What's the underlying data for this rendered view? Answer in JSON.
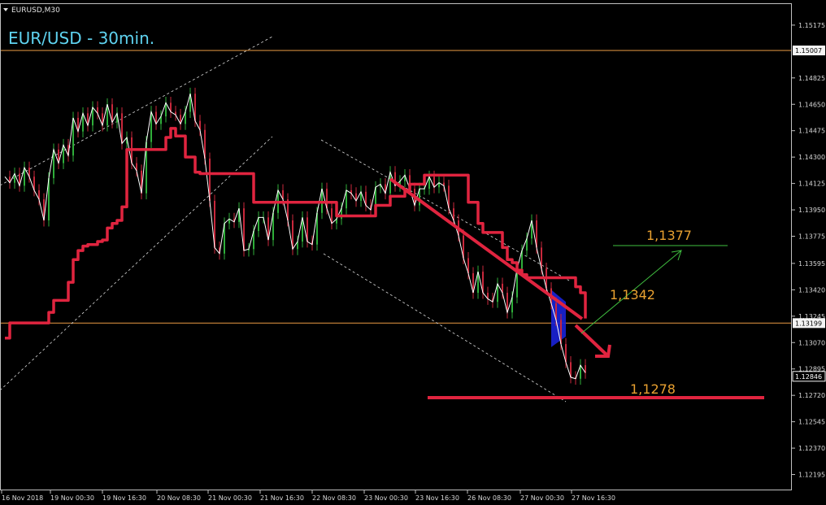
{
  "window": {
    "symbol_label": "EURUSD,M30",
    "menu_icon": "triangle-down-icon"
  },
  "colors": {
    "background": "#000000",
    "frame": "#c0c0c0",
    "grid_text": "#d6d6d6",
    "hline": "#d08a3c",
    "kijun": "#e0243f",
    "close_line": "#ffffff",
    "candles": "#2fae3a",
    "candles_down": "#c8283c",
    "channel": "#dcdcdc",
    "target": "#e8a030",
    "bull_arrow": "#40c040",
    "cloud": "#1a22d8",
    "title": "#5fd3f0"
  },
  "chart_data": {
    "type": "line",
    "title": "EUR/USD - 30min.",
    "xlabel": "",
    "ylabel": "",
    "ylim": [
      1.1209,
      1.1532
    ],
    "y_ticks": [
      "1.15175",
      "1.15007",
      "1.14825",
      "1.14650",
      "1.14475",
      "1.14300",
      "1.14125",
      "1.13950",
      "1.13775",
      "1.13595",
      "1.13420",
      "1.13245",
      "1.13199",
      "1.13070",
      "1.12895",
      "1.12846",
      "1.12720",
      "1.12545",
      "1.12370",
      "1.12195"
    ],
    "x_ticks": [
      "16 Nov 2018",
      "19 Nov 00:30",
      "19 Nov 16:30",
      "20 Nov 08:30",
      "21 Nov 00:30",
      "21 Nov 16:30",
      "22 Nov 08:30",
      "23 Nov 00:30",
      "23 Nov 16:30",
      "26 Nov 08:30",
      "27 Nov 00:30",
      "27 Nov 16:30"
    ],
    "horizontal_lines": [
      {
        "value": 1.15007,
        "label": "1.15007"
      },
      {
        "value": 1.13199,
        "label": "1.13199"
      }
    ],
    "current_price": {
      "value": 1.12846,
      "label": "1.12846"
    },
    "annotations": [
      {
        "text": "1,1377",
        "kind": "bullish-target"
      },
      {
        "text": "1,1342",
        "kind": "resistance"
      },
      {
        "text": "1,1278",
        "kind": "support"
      }
    ],
    "series": [
      {
        "kind": "close",
        "values": [
          1.1417,
          1.1413,
          1.1419,
          1.1411,
          1.1423,
          1.1417,
          1.1408,
          1.1402,
          1.1388,
          1.1416,
          1.1435,
          1.1426,
          1.1438,
          1.1431,
          1.1456,
          1.1447,
          1.1459,
          1.1451,
          1.1463,
          1.1459,
          1.1451,
          1.1465,
          1.1453,
          1.1459,
          1.1439,
          1.1443,
          1.1426,
          1.1421,
          1.1406,
          1.144,
          1.146,
          1.1452,
          1.1457,
          1.1466,
          1.146,
          1.1458,
          1.1452,
          1.146,
          1.1472,
          1.1454,
          1.1448,
          1.1429,
          1.1401,
          1.137,
          1.1366,
          1.1386,
          1.1389,
          1.1387,
          1.1396,
          1.1368,
          1.1369,
          1.1381,
          1.139,
          1.139,
          1.1375,
          1.1393,
          1.1408,
          1.1402,
          1.1388,
          1.1369,
          1.1374,
          1.139,
          1.1374,
          1.1372,
          1.1393,
          1.1409,
          1.1396,
          1.1386,
          1.1389,
          1.1396,
          1.1408,
          1.1406,
          1.1401,
          1.1407,
          1.1398,
          1.1395,
          1.141,
          1.1412,
          1.1406,
          1.142,
          1.1411,
          1.1414,
          1.1418,
          1.1409,
          1.1398,
          1.1409,
          1.1409,
          1.1417,
          1.141,
          1.1413,
          1.1411,
          1.1396,
          1.1388,
          1.1378,
          1.1363,
          1.1353,
          1.134,
          1.1354,
          1.134,
          1.1336,
          1.1334,
          1.1346,
          1.134,
          1.1327,
          1.1337,
          1.1356,
          1.1368,
          1.1376,
          1.1388,
          1.137,
          1.1356,
          1.1343,
          1.1333,
          1.1322,
          1.1306,
          1.1294,
          1.1284,
          1.1283,
          1.1292,
          1.1287
        ]
      },
      {
        "kind": "kijun",
        "values": [
          1.131,
          1.132,
          1.132,
          1.132,
          1.132,
          1.132,
          1.132,
          1.132,
          1.132,
          1.1327,
          1.1335,
          1.1335,
          1.1335,
          1.1347,
          1.1362,
          1.1368,
          1.1371,
          1.1372,
          1.1372,
          1.1374,
          1.1375,
          1.1383,
          1.1386,
          1.1388,
          1.1397,
          1.1435,
          1.1435,
          1.1435,
          1.1435,
          1.1435,
          1.1435,
          1.1435,
          1.1435,
          1.1443,
          1.1449,
          1.1444,
          1.1444,
          1.143,
          1.143,
          1.142,
          1.1419,
          1.1419,
          1.1419,
          1.1419,
          1.1419,
          1.1419,
          1.1419,
          1.1419,
          1.1419,
          1.1419,
          1.1419,
          1.14,
          1.14,
          1.14,
          1.14,
          1.14,
          1.14,
          1.14,
          1.14,
          1.14,
          1.14,
          1.14,
          1.14,
          1.14,
          1.14,
          1.14,
          1.14,
          1.14,
          1.1391,
          1.1391,
          1.1391,
          1.1391,
          1.1391,
          1.1391,
          1.1391,
          1.1391,
          1.1398,
          1.1398,
          1.1398,
          1.1404,
          1.1404,
          1.1404,
          1.1408,
          1.1412,
          1.1412,
          1.1412,
          1.1418,
          1.1418,
          1.1418,
          1.1418,
          1.1418,
          1.1418,
          1.1418,
          1.1418,
          1.1418,
          1.14,
          1.14,
          1.1386,
          1.138,
          1.138,
          1.138,
          1.138,
          1.137,
          1.1362,
          1.136,
          1.1355,
          1.1352,
          1.135,
          1.135,
          1.135,
          1.135,
          1.135,
          1.135,
          1.135,
          1.135,
          1.135,
          1.135,
          1.1344,
          1.134,
          1.1323
        ]
      }
    ]
  }
}
